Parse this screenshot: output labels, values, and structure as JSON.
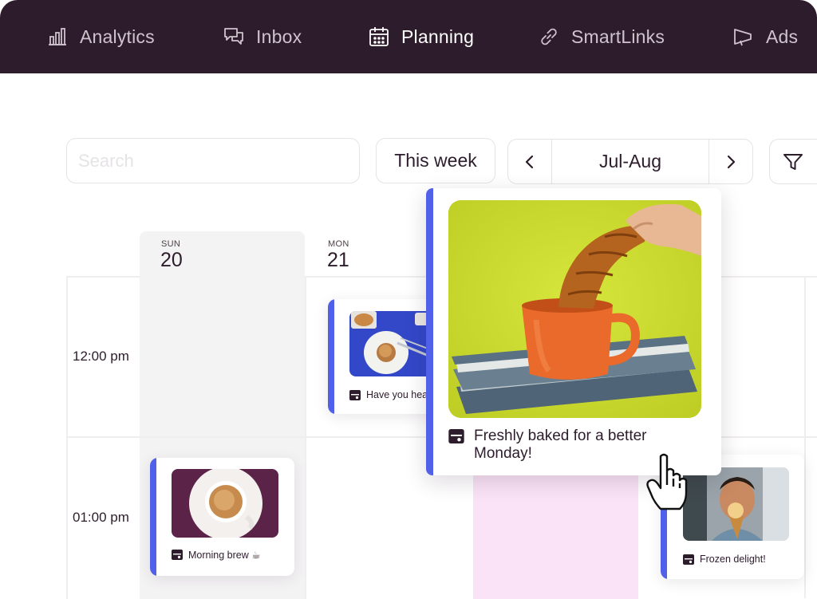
{
  "nav": {
    "items": [
      {
        "label": "Analytics",
        "icon": "bar-chart-icon",
        "active": false
      },
      {
        "label": "Inbox",
        "icon": "chat-bubbles-icon",
        "active": false
      },
      {
        "label": "Planning",
        "icon": "calendar-icon",
        "active": true
      },
      {
        "label": "SmartLinks",
        "icon": "link-icon",
        "active": false
      },
      {
        "label": "Ads",
        "icon": "megaphone-icon",
        "active": false
      }
    ]
  },
  "toolbar": {
    "search_placeholder": "Search",
    "week_button": "This week",
    "date_range": "Jul-Aug",
    "prev_icon": "chevron-left-icon",
    "next_icon": "chevron-right-icon",
    "filter_icon": "filter-icon"
  },
  "calendar": {
    "days": [
      {
        "dow": "SUN",
        "num": "20"
      },
      {
        "dow": "MON",
        "num": "21"
      }
    ],
    "times": [
      "12:00 pm",
      "01:00 pm"
    ]
  },
  "posts": {
    "morning": {
      "caption": "Morning brew ☕",
      "icon": "store-icon"
    },
    "have_you": {
      "caption": "Have you hea",
      "icon": "store-icon"
    },
    "featured": {
      "caption": "Freshly baked for a better Monday!",
      "icon": "store-icon"
    },
    "frozen": {
      "caption": "Frozen delight!",
      "icon": "store-icon"
    }
  },
  "colors": {
    "nav_bg": "#2d1c2b",
    "accent": "#5160e8",
    "highlight_slot": "#fae3f6",
    "sunday_column": "#f4f3f4"
  }
}
